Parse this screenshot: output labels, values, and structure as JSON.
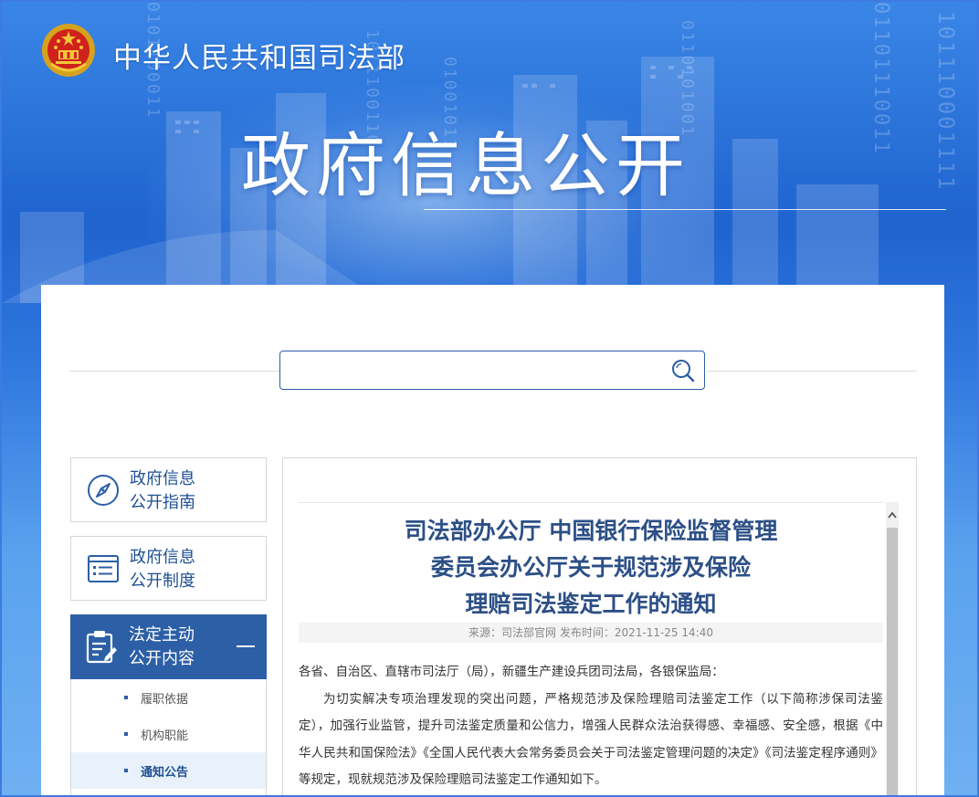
{
  "header": {
    "ministry_name": "中华人民共和国司法部",
    "banner_title": "政府信息公开",
    "binary_decor": [
      "0101100011",
      "1011100110",
      "0110101001",
      "01101110011",
      "101110001111",
      "01001011"
    ]
  },
  "search": {
    "placeholder": "",
    "value": ""
  },
  "sidebar": {
    "items": [
      {
        "label_line1": "政府信息",
        "label_line2": "公开指南",
        "icon": "compass-icon"
      },
      {
        "label_line1": "政府信息",
        "label_line2": "公开制度",
        "icon": "list-document-icon"
      },
      {
        "label_line1": "法定主动",
        "label_line2": "公开内容",
        "icon": "edit-document-icon",
        "expanded": true
      }
    ],
    "subitems": [
      {
        "label": "履职依据"
      },
      {
        "label": "机构职能"
      },
      {
        "label": "通知公告",
        "active": true
      }
    ]
  },
  "article": {
    "title_lines": [
      "司法部办公厅 中国银行保险监督管理",
      "委员会办公厅关于规范涉及保险",
      "理赔司法鉴定工作的通知"
    ],
    "meta": "来源：司法部官网 发布时间：2021-11-25 14:40",
    "salutation": "各省、自治区、直辖市司法厅（局），新疆生产建设兵团司法局，各银保监局：",
    "paragraph1": "为切实解决专项治理发现的突出问题，严格规范涉及保险理赔司法鉴定工作（以下简称涉保司法鉴定），加强行业监管，提升司法鉴定质量和公信力，增强人民群众法治获得感、幸福感、安全感，根据《中华人民共和国保险法》《全国人民代表大会常务委员会关于司法鉴定管理问题的决定》《司法鉴定程序通则》等规定，现就规范涉及保险理赔司法鉴定工作通知如下。"
  },
  "colors": {
    "accent": "#2c5fa6",
    "title": "#2c4f86",
    "banner": "#1f63cf"
  }
}
